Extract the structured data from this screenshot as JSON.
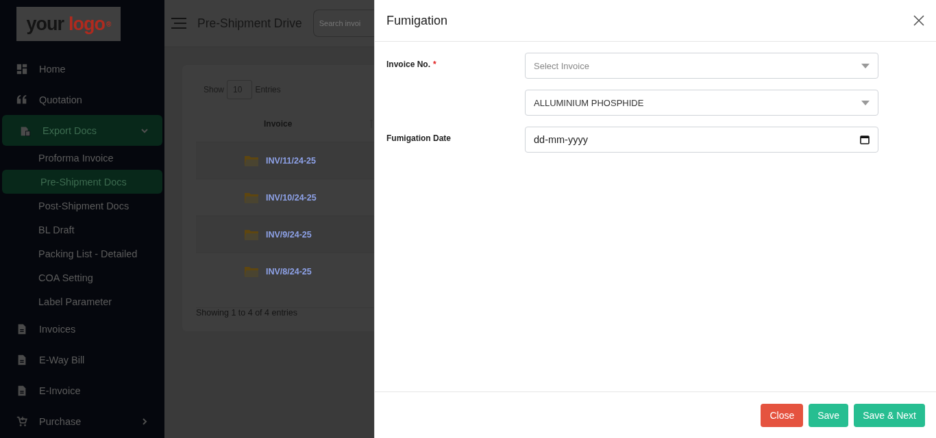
{
  "sidebar": {
    "logo": {
      "word_1": "your",
      "word_2": "logo",
      "mark": "®"
    },
    "items": [
      {
        "label": "Home",
        "selected": false
      },
      {
        "label": "Quotation",
        "selected": false
      },
      {
        "label": "Export Docs",
        "selected": true,
        "expanded": true,
        "children": [
          {
            "label": "Proforma Invoice",
            "selected": false
          },
          {
            "label": "Pre-Shipment Docs",
            "selected": true
          },
          {
            "label": "Post-Shipment Docs",
            "selected": false
          },
          {
            "label": "BL Draft",
            "selected": false
          },
          {
            "label": "Packing List - Detailed",
            "selected": false
          },
          {
            "label": "COA Setting",
            "selected": false
          },
          {
            "label": "Label Parameter",
            "selected": false
          }
        ]
      },
      {
        "label": "Invoices",
        "selected": false
      },
      {
        "label": "E-Way Bill",
        "selected": false
      },
      {
        "label": "E-Invoice",
        "selected": false
      },
      {
        "label": "Purchase",
        "selected": false,
        "expanded": false
      }
    ]
  },
  "topbar": {
    "title": "Pre-Shipment Drive",
    "search": {
      "placeholder": "Search invoi"
    }
  },
  "table": {
    "show_label": "Show",
    "page_size": "10",
    "entries_label": "Entries",
    "columns": [
      "Invoice"
    ],
    "rows": [
      {
        "invoice": "INV/11/24-25"
      },
      {
        "invoice": "INV/10/24-25"
      },
      {
        "invoice": "INV/9/24-25"
      },
      {
        "invoice": "INV/8/24-25"
      }
    ],
    "footer": "Showing 1 to 4 of 4 entries"
  },
  "modal": {
    "title": "Fumigation",
    "fields": [
      {
        "kind": "select",
        "label": "Invoice No.",
        "required_mark": "*",
        "placeholder": "Select Invoice"
      },
      {
        "kind": "select",
        "value": "ALLUMINIUM PHOSPHIDE"
      },
      {
        "kind": "date",
        "label": "Fumigation Date",
        "placeholder": "dd-mm-yyyy"
      }
    ],
    "buttons": [
      {
        "kind": "danger",
        "label": "Close"
      },
      {
        "kind": "primary",
        "label": "Save"
      },
      {
        "kind": "primary",
        "label": "Save & Next"
      }
    ]
  }
}
